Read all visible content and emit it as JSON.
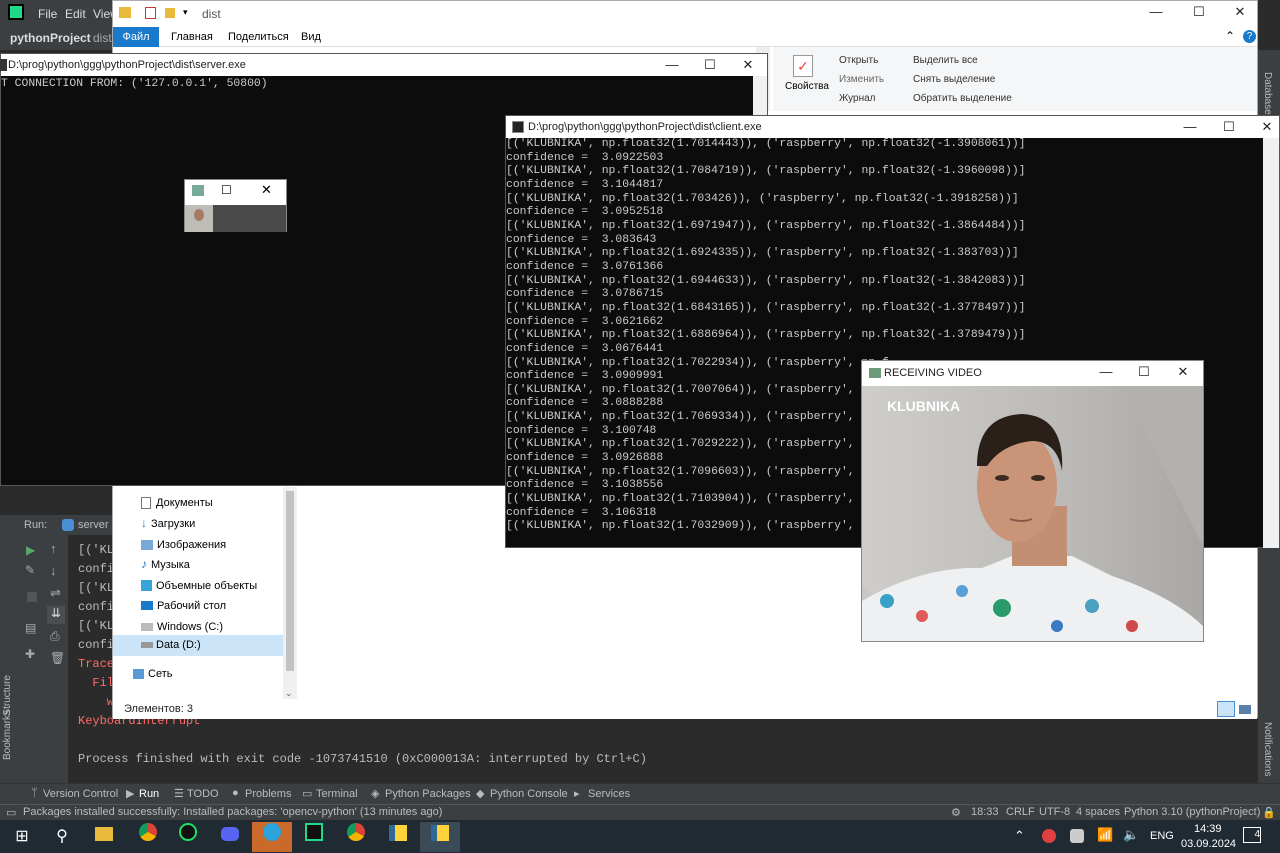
{
  "pycharm": {
    "menu": [
      "File",
      "Edit",
      "View"
    ],
    "project": "pythonProject",
    "crumb": "dist",
    "run_label": "Run:",
    "run_tab": "server",
    "console_lines": [
      "[('KL",
      "confi",
      "[('KL",
      "confi",
      "[('KL",
      "confi",
      "Trace",
      "  Fil",
      "    w",
      "KeyboardInterrupt",
      "",
      "Process finished with exit code -1073741510 (0xC000013A: interrupted by Ctrl+C)"
    ],
    "right_strip": "Database",
    "left_strip": [
      "Structure",
      "Bookmarks"
    ],
    "notifications": "Notifications",
    "bottom_tabs": [
      "Version Control",
      "Run",
      "TODO",
      "Problems",
      "Terminal",
      "Python Packages",
      "Python Console",
      "Services"
    ],
    "status_message": "Packages installed successfully: Installed packages: 'opencv-python' (13 minutes ago)",
    "status_right": [
      "18:33",
      "CRLF",
      "UTF-8",
      "4 spaces",
      "Python 3.10 (pythonProject)"
    ]
  },
  "explorer": {
    "title": "dist",
    "tabs": [
      "Файл",
      "Главная",
      "Поделиться",
      "Вид"
    ],
    "ribbon": {
      "properties": "Свойства",
      "open": "Открыть",
      "edit": "Изменить",
      "history": "Журнал",
      "select_all": "Выделить все",
      "deselect": "Снять выделение",
      "invert": "Обратить выделение"
    },
    "nav_items": [
      "Документы",
      "Загрузки",
      "Изображения",
      "Музыка",
      "Объемные объекты",
      "Рабочий стол",
      "Windows (C:)",
      "Data (D:)",
      "Сеть"
    ],
    "status": "Элементов: 3"
  },
  "server_window": {
    "title": "D:\\prog\\python\\ggg\\pythonProject\\dist\\server.exe",
    "line": "T CONNECTION FROM: ('127.0.0.1', 50800)"
  },
  "client_window": {
    "title": "D:\\prog\\python\\ggg\\pythonProject\\dist\\client.exe",
    "lines": [
      "[('KLUBNIKA', np.float32(1.7014443)), ('raspberry', np.float32(-1.3908061))]",
      "confidence =  3.0922503",
      "[('KLUBNIKA', np.float32(1.7084719)), ('raspberry', np.float32(-1.3960098))]",
      "confidence =  3.1044817",
      "[('KLUBNIKA', np.float32(1.703426)), ('raspberry', np.float32(-1.3918258))]",
      "confidence =  3.0952518",
      "[('KLUBNIKA', np.float32(1.6971947)), ('raspberry', np.float32(-1.3864484))]",
      "confidence =  3.083643",
      "[('KLUBNIKA', np.float32(1.6924335)), ('raspberry', np.float32(-1.383703))]",
      "confidence =  3.0761366",
      "[('KLUBNIKA', np.float32(1.6944633)), ('raspberry', np.float32(-1.3842083))]",
      "confidence =  3.0786715",
      "[('KLUBNIKA', np.float32(1.6843165)), ('raspberry', np.float32(-1.3778497))]",
      "confidence =  3.0621662",
      "[('KLUBNIKA', np.float32(1.6886964)), ('raspberry', np.float32(-1.3789479))]",
      "confidence =  3.0676441",
      "[('KLUBNIKA', np.float32(1.7022934)), ('raspberry', np.f",
      "confidence =  3.0909991",
      "[('KLUBNIKA', np.float32(1.7007064)), ('raspberry', np.f",
      "confidence =  3.0888288",
      "[('KLUBNIKA', np.float32(1.7069334)), ('raspberry', np.f",
      "confidence =  3.100748",
      "[('KLUBNIKA', np.float32(1.7029222)), ('raspberry', np.f",
      "confidence =  3.0926888",
      "[('KLUBNIKA', np.float32(1.7096603)), ('raspberry', np.f",
      "confidence =  3.1038556",
      "[('KLUBNIKA', np.float32(1.7103904)), ('raspberry', np.f",
      "confidence =  3.106318",
      "[('KLUBNIKA', np.float32(1.7032909)), ('raspberry', np.f"
    ]
  },
  "video_window": {
    "title": "RECEIVING VIDEO",
    "overlay": "KLUBNIKA"
  },
  "taskbar": {
    "lang": "ENG",
    "time": "14:39",
    "date": "03.09.2024",
    "notif_count": "4"
  }
}
